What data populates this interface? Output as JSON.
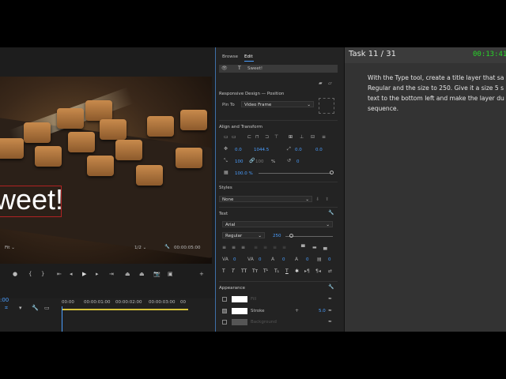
{
  "monitor": {
    "title_text": "weet!",
    "fit_label": "Fit",
    "resolution": "1/2",
    "timecode": "00:00:05:00",
    "timeline_timecode": ":00",
    "ruler": [
      "00:00",
      "00:00:01:00",
      "00:00:02:00",
      "00:00:03:00",
      "00"
    ]
  },
  "eg": {
    "tabs": [
      "Browse",
      "Edit"
    ],
    "layer_name": "Sweet!",
    "responsive_title": "Responsive Design — Position",
    "pin_to_label": "Pin To",
    "pin_to_value": "Video Frame",
    "align_title": "Align and Transform",
    "pos_x": "0.0",
    "pos_y": "1044.5",
    "anchor_x": "0.0",
    "anchor_y": "0.0",
    "scale": "100",
    "scale_locked": "100",
    "scale_unit": "%",
    "rotation": "0",
    "opacity": "100.0 %",
    "styles_title": "Styles",
    "styles_value": "None",
    "text_title": "Text",
    "font": "Arial",
    "font_style": "Regular",
    "font_size": "250",
    "tracking": [
      "0",
      "0",
      "0",
      "0",
      "0",
      "0"
    ],
    "appearance_title": "Appearance",
    "appearance_items": [
      {
        "label": "Fill",
        "checked": false,
        "color": "#ffffff",
        "value": ""
      },
      {
        "label": "Stroke",
        "checked": true,
        "color": "#ffffff",
        "value": "5.0"
      },
      {
        "label": "Background",
        "checked": false,
        "color": "#555555",
        "value": ""
      }
    ]
  },
  "task": {
    "title": "Task 11 / 31",
    "timer": "00:13:41",
    "instructions": "With the Type tool, create a title layer that sa\nRegular and the size to 250. Give it a size 5 s\ntext to the bottom left and make the layer du\nsequence."
  },
  "colors": {
    "accent": "#4a9eff",
    "timer": "#28d428",
    "selection_border": "#b02323"
  }
}
